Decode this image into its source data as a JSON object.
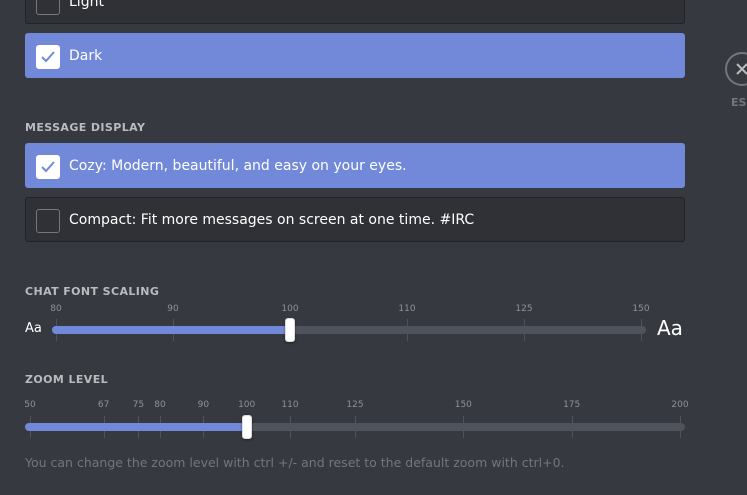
{
  "theme": {
    "options": [
      {
        "label": "Light",
        "checked": false
      },
      {
        "label": "Dark",
        "checked": true
      }
    ]
  },
  "message_display": {
    "title": "MESSAGE DISPLAY",
    "options": [
      {
        "label": "Cozy: Modern, beautiful, and easy on your eyes.",
        "checked": true
      },
      {
        "label": "Compact: Fit more messages on screen at one time. #IRC",
        "checked": false
      }
    ]
  },
  "chat_font_scaling": {
    "title": "CHAT FONT SCALING",
    "ticks": [
      "80",
      "90",
      "100",
      "110",
      "125",
      "150"
    ],
    "value": 100,
    "aa_small": "Aa",
    "aa_large": "Aa"
  },
  "zoom_level": {
    "title": "ZOOM LEVEL",
    "ticks": [
      "50",
      "67",
      "75",
      "80",
      "90",
      "100",
      "110",
      "125",
      "150",
      "175",
      "200"
    ],
    "value": 100,
    "hint": "You can change the zoom level with ctrl +/- and reset to the default zoom with ctrl+0."
  },
  "close": {
    "label": "ESC",
    "icon": "close-icon"
  },
  "colors": {
    "accent": "#7289da",
    "background": "#36393f",
    "panel": "#2f3136"
  }
}
